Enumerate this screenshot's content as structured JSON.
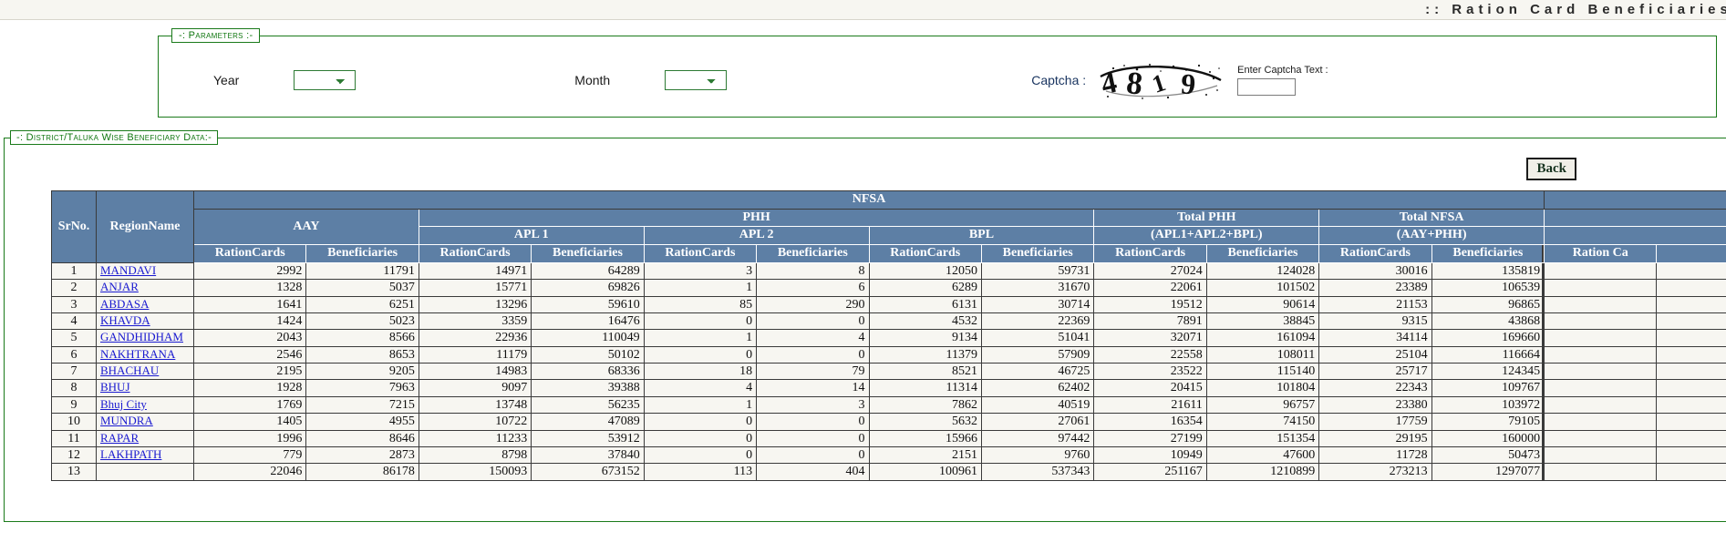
{
  "titlebar": {
    "title": ":: Ration Card Beneficiaries :"
  },
  "parameters": {
    "legend": "-: Parameters :-",
    "year_label": "Year",
    "year_value": "",
    "month_label": "Month",
    "month_value": "",
    "captcha_label": "Captcha :",
    "captcha_text": "4819",
    "captcha_entry_label": "Enter Captcha Text :",
    "captcha_input_value": "",
    "captcha_input_placeholder": ""
  },
  "data_section": {
    "legend": "-: District/Taluka Wise Beneficiary Data:-",
    "back_label": "Back"
  },
  "table": {
    "group_top": "NFSA",
    "headers": {
      "srno": "SrNo.",
      "region": "RegionName",
      "aay": "AAY",
      "phh": "PHH",
      "apl1": "APL 1",
      "apl2": "APL 2",
      "bpl": "BPL",
      "total_phh": "Total PHH",
      "total_phh_sub": "(APL1+APL2+BPL)",
      "total_nfsa": "Total NFSA",
      "total_nfsa_sub": "(AAY+PHH)",
      "rationcards": "RationCards",
      "beneficiaries": "Beneficiaries",
      "rationcards_cut": "Ration Ca"
    },
    "rows": [
      {
        "srno": "1",
        "region": "MANDAVI",
        "aay_rc": "2992",
        "aay_ben": "11791",
        "apl1_rc": "14971",
        "apl1_ben": "64289",
        "apl2_rc": "3",
        "apl2_ben": "8",
        "bpl_rc": "12050",
        "bpl_ben": "59731",
        "tphh_rc": "27024",
        "tphh_ben": "124028",
        "tnfsa_rc": "30016",
        "tnfsa_ben": "135819"
      },
      {
        "srno": "2",
        "region": "ANJAR",
        "aay_rc": "1328",
        "aay_ben": "5037",
        "apl1_rc": "15771",
        "apl1_ben": "69826",
        "apl2_rc": "1",
        "apl2_ben": "6",
        "bpl_rc": "6289",
        "bpl_ben": "31670",
        "tphh_rc": "22061",
        "tphh_ben": "101502",
        "tnfsa_rc": "23389",
        "tnfsa_ben": "106539"
      },
      {
        "srno": "3",
        "region": "ABDASA",
        "aay_rc": "1641",
        "aay_ben": "6251",
        "apl1_rc": "13296",
        "apl1_ben": "59610",
        "apl2_rc": "85",
        "apl2_ben": "290",
        "bpl_rc": "6131",
        "bpl_ben": "30714",
        "tphh_rc": "19512",
        "tphh_ben": "90614",
        "tnfsa_rc": "21153",
        "tnfsa_ben": "96865"
      },
      {
        "srno": "4",
        "region": "KHAVDA",
        "aay_rc": "1424",
        "aay_ben": "5023",
        "apl1_rc": "3359",
        "apl1_ben": "16476",
        "apl2_rc": "0",
        "apl2_ben": "0",
        "bpl_rc": "4532",
        "bpl_ben": "22369",
        "tphh_rc": "7891",
        "tphh_ben": "38845",
        "tnfsa_rc": "9315",
        "tnfsa_ben": "43868"
      },
      {
        "srno": "5",
        "region": "GANDHIDHAM",
        "aay_rc": "2043",
        "aay_ben": "8566",
        "apl1_rc": "22936",
        "apl1_ben": "110049",
        "apl2_rc": "1",
        "apl2_ben": "4",
        "bpl_rc": "9134",
        "bpl_ben": "51041",
        "tphh_rc": "32071",
        "tphh_ben": "161094",
        "tnfsa_rc": "34114",
        "tnfsa_ben": "169660"
      },
      {
        "srno": "6",
        "region": "NAKHTRANA",
        "aay_rc": "2546",
        "aay_ben": "8653",
        "apl1_rc": "11179",
        "apl1_ben": "50102",
        "apl2_rc": "0",
        "apl2_ben": "0",
        "bpl_rc": "11379",
        "bpl_ben": "57909",
        "tphh_rc": "22558",
        "tphh_ben": "108011",
        "tnfsa_rc": "25104",
        "tnfsa_ben": "116664"
      },
      {
        "srno": "7",
        "region": "BHACHAU",
        "aay_rc": "2195",
        "aay_ben": "9205",
        "apl1_rc": "14983",
        "apl1_ben": "68336",
        "apl2_rc": "18",
        "apl2_ben": "79",
        "bpl_rc": "8521",
        "bpl_ben": "46725",
        "tphh_rc": "23522",
        "tphh_ben": "115140",
        "tnfsa_rc": "25717",
        "tnfsa_ben": "124345"
      },
      {
        "srno": "8",
        "region": "BHUJ",
        "aay_rc": "1928",
        "aay_ben": "7963",
        "apl1_rc": "9097",
        "apl1_ben": "39388",
        "apl2_rc": "4",
        "apl2_ben": "14",
        "bpl_rc": "11314",
        "bpl_ben": "62402",
        "tphh_rc": "20415",
        "tphh_ben": "101804",
        "tnfsa_rc": "22343",
        "tnfsa_ben": "109767"
      },
      {
        "srno": "9",
        "region": "Bhuj City",
        "aay_rc": "1769",
        "aay_ben": "7215",
        "apl1_rc": "13748",
        "apl1_ben": "56235",
        "apl2_rc": "1",
        "apl2_ben": "3",
        "bpl_rc": "7862",
        "bpl_ben": "40519",
        "tphh_rc": "21611",
        "tphh_ben": "96757",
        "tnfsa_rc": "23380",
        "tnfsa_ben": "103972"
      },
      {
        "srno": "10",
        "region": "MUNDRA",
        "aay_rc": "1405",
        "aay_ben": "4955",
        "apl1_rc": "10722",
        "apl1_ben": "47089",
        "apl2_rc": "0",
        "apl2_ben": "0",
        "bpl_rc": "5632",
        "bpl_ben": "27061",
        "tphh_rc": "16354",
        "tphh_ben": "74150",
        "tnfsa_rc": "17759",
        "tnfsa_ben": "79105"
      },
      {
        "srno": "11",
        "region": "RAPAR",
        "aay_rc": "1996",
        "aay_ben": "8646",
        "apl1_rc": "11233",
        "apl1_ben": "53912",
        "apl2_rc": "0",
        "apl2_ben": "0",
        "bpl_rc": "15966",
        "bpl_ben": "97442",
        "tphh_rc": "27199",
        "tphh_ben": "151354",
        "tnfsa_rc": "29195",
        "tnfsa_ben": "160000"
      },
      {
        "srno": "12",
        "region": "LAKHPATH",
        "aay_rc": "779",
        "aay_ben": "2873",
        "apl1_rc": "8798",
        "apl1_ben": "37840",
        "apl2_rc": "0",
        "apl2_ben": "0",
        "bpl_rc": "2151",
        "bpl_ben": "9760",
        "tphh_rc": "10949",
        "tphh_ben": "47600",
        "tnfsa_rc": "11728",
        "tnfsa_ben": "50473"
      },
      {
        "srno": "13",
        "region": "",
        "aay_rc": "22046",
        "aay_ben": "86178",
        "apl1_rc": "150093",
        "apl1_ben": "673152",
        "apl2_rc": "113",
        "apl2_ben": "404",
        "bpl_rc": "100961",
        "bpl_ben": "537343",
        "tphh_rc": "251167",
        "tphh_ben": "1210899",
        "tnfsa_rc": "273213",
        "tnfsa_ben": "1297077"
      }
    ]
  }
}
